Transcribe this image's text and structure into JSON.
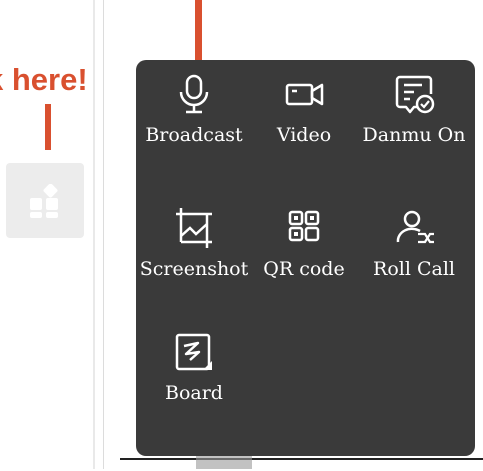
{
  "callout": {
    "text": "k here!"
  },
  "sidebar": {
    "app_icon": "apps-grid-icon"
  },
  "panel": {
    "background": "#3a3a3a",
    "tools": [
      {
        "label": "Broadcast",
        "icon": "microphone-icon"
      },
      {
        "label": "Video",
        "icon": "video-camera-icon"
      },
      {
        "label": "Danmu On",
        "icon": "danmu-icon"
      },
      {
        "label": "Screenshot",
        "icon": "screenshot-icon"
      },
      {
        "label": "QR code",
        "icon": "qr-code-icon"
      },
      {
        "label": "Roll Call",
        "icon": "roll-call-icon"
      },
      {
        "label": "Board",
        "icon": "board-icon"
      }
    ]
  },
  "colors": {
    "annotation": "#d9502f"
  }
}
